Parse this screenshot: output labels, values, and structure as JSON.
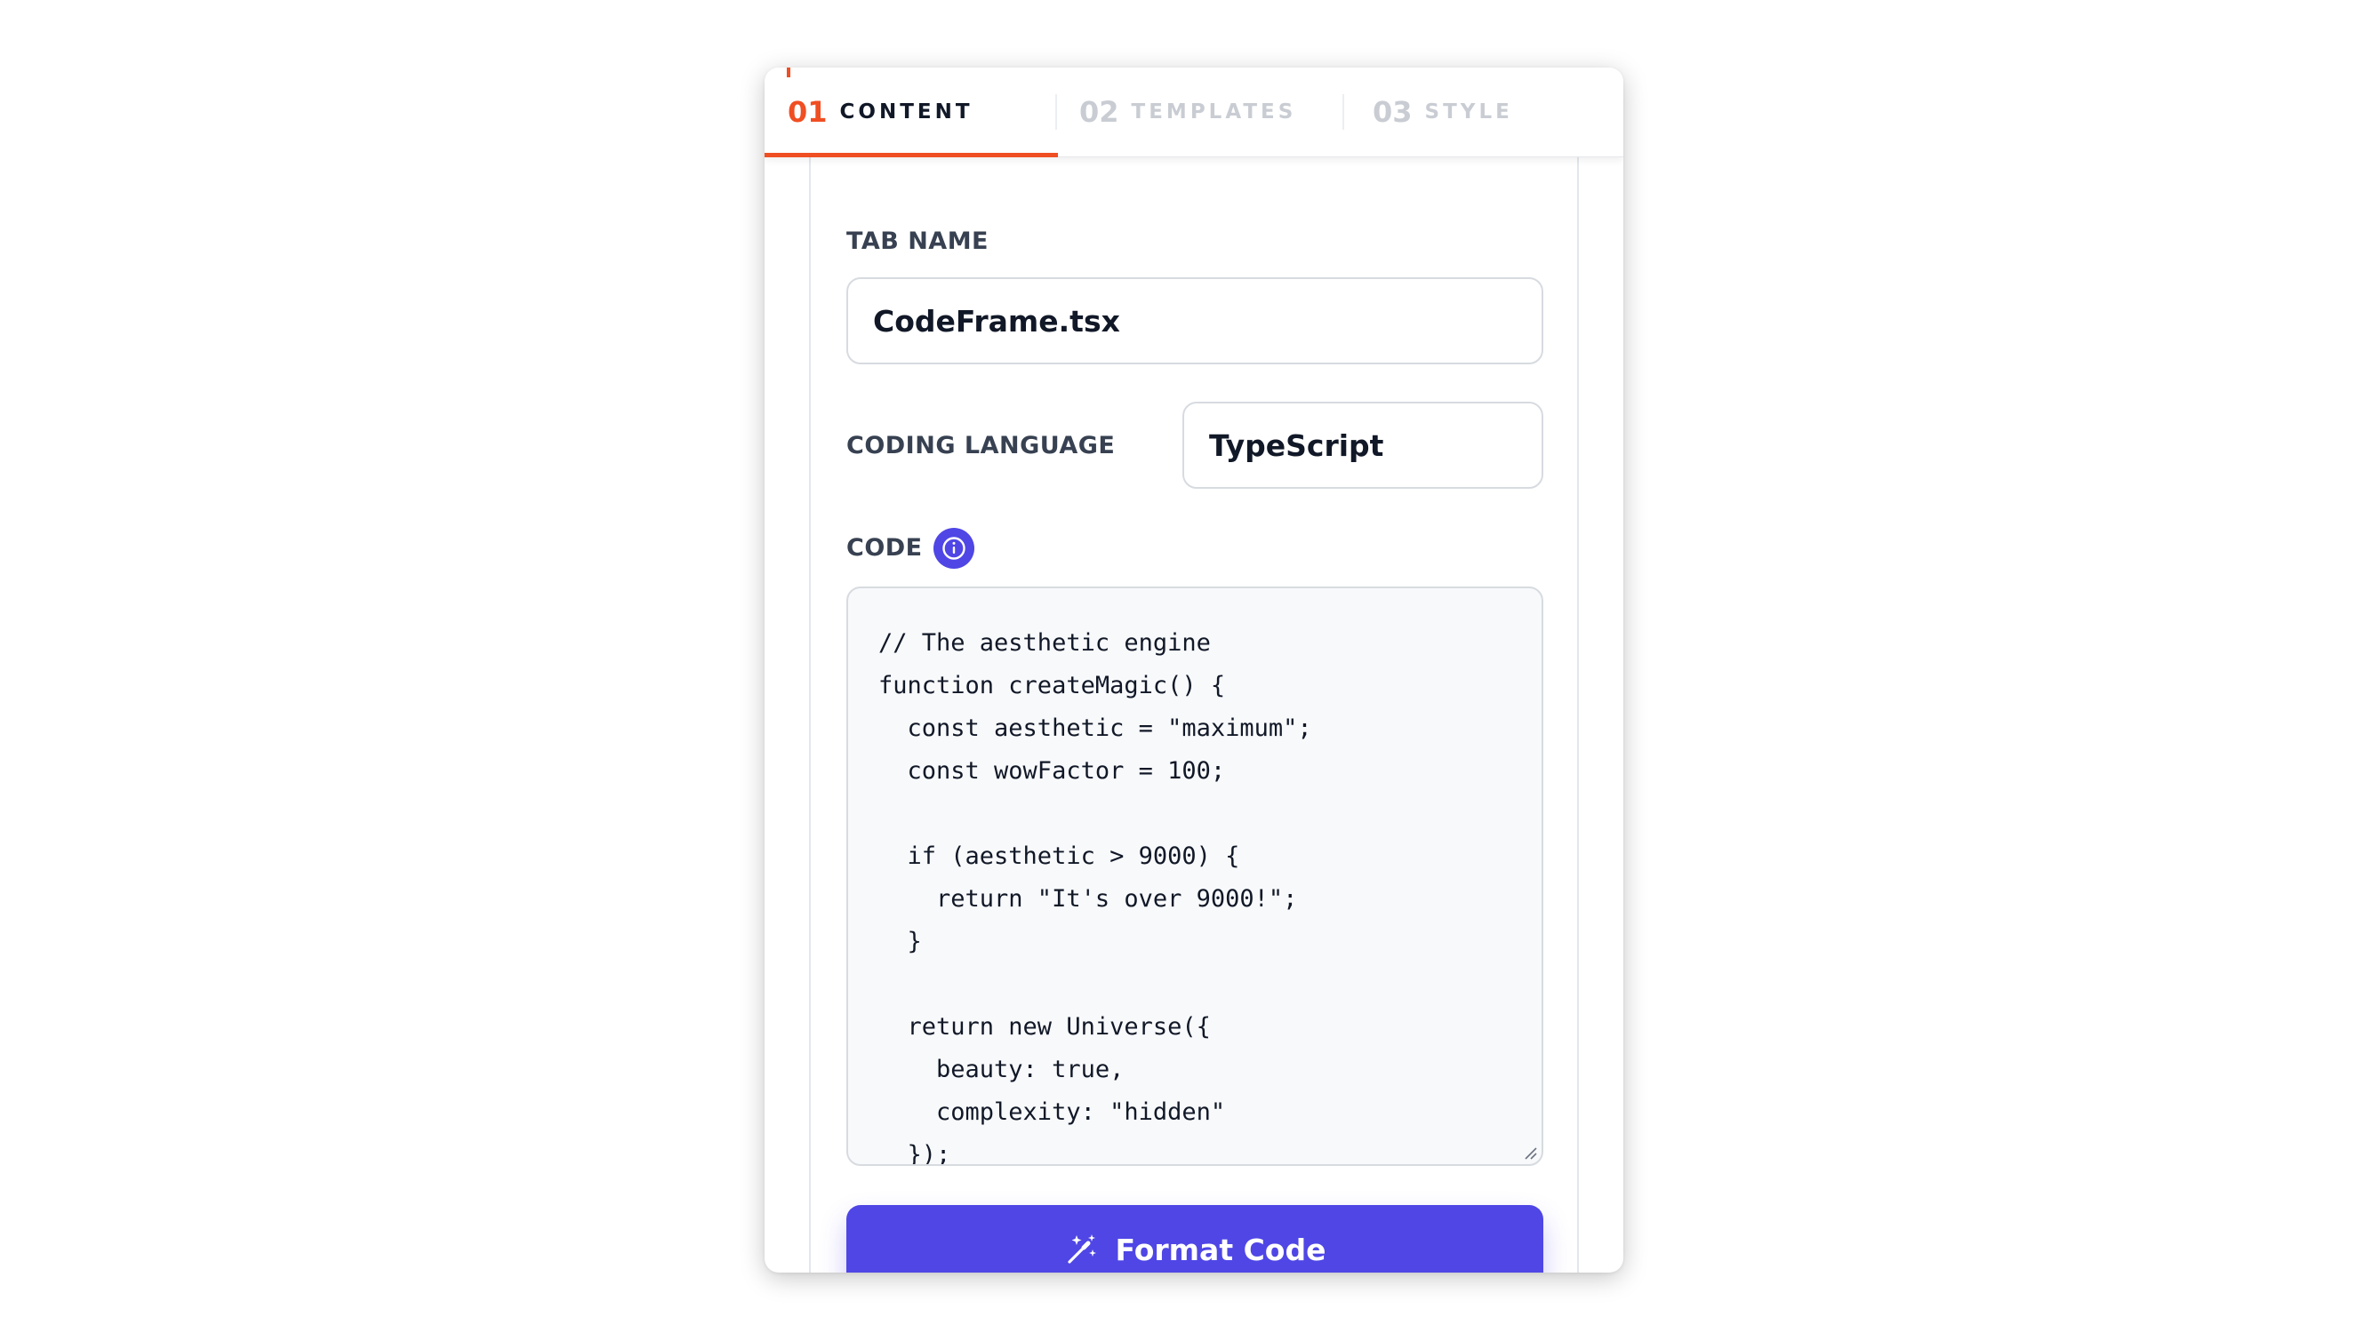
{
  "tabs": [
    {
      "number": "01",
      "label": "CONTENT",
      "active": true
    },
    {
      "number": "02",
      "label": "TEMPLATES",
      "active": false
    },
    {
      "number": "03",
      "label": "STYLE",
      "active": false
    }
  ],
  "form": {
    "tab_name_label": "TAB NAME",
    "tab_name_value": "CodeFrame.tsx",
    "language_label": "CODING LANGUAGE",
    "language_value": "TypeScript",
    "code_label": "CODE",
    "code_value": "// The aesthetic engine\nfunction createMagic() {\n  const aesthetic = \"maximum\";\n  const wowFactor = 100;\n\n  if (aesthetic > 9000) {\n    return \"It's over 9000!\";\n  }\n\n  return new Universe({\n    beauty: true,\n    complexity: \"hidden\"\n  });",
    "format_button_label": "Format Code"
  },
  "icons": {
    "info": "info-icon",
    "format": "magic-wand-icon"
  },
  "colors": {
    "accent": "#f04e23",
    "primary": "#4f46e5",
    "label": "#374151",
    "text": "#111827",
    "inactive_tab": "#c9cdd3"
  }
}
